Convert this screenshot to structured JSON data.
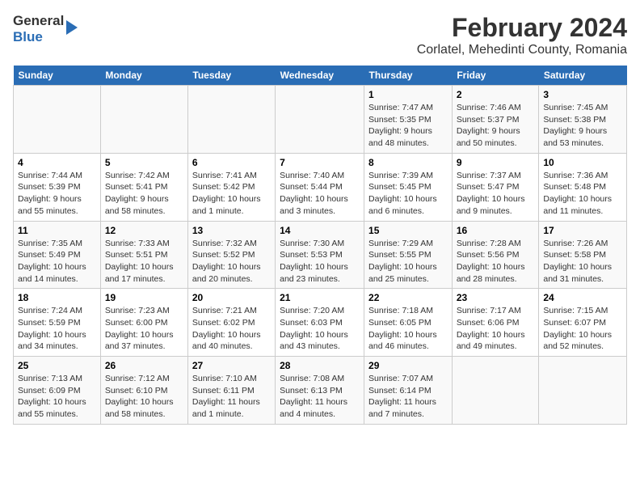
{
  "header": {
    "logo_line1": "General",
    "logo_line2": "Blue",
    "title": "February 2024",
    "subtitle": "Corlatel, Mehedinti County, Romania"
  },
  "days_of_week": [
    "Sunday",
    "Monday",
    "Tuesday",
    "Wednesday",
    "Thursday",
    "Friday",
    "Saturday"
  ],
  "weeks": [
    [
      {
        "num": "",
        "sunrise": "",
        "sunset": "",
        "daylight": ""
      },
      {
        "num": "",
        "sunrise": "",
        "sunset": "",
        "daylight": ""
      },
      {
        "num": "",
        "sunrise": "",
        "sunset": "",
        "daylight": ""
      },
      {
        "num": "",
        "sunrise": "",
        "sunset": "",
        "daylight": ""
      },
      {
        "num": "1",
        "sunrise": "Sunrise: 7:47 AM",
        "sunset": "Sunset: 5:35 PM",
        "daylight": "Daylight: 9 hours and 48 minutes."
      },
      {
        "num": "2",
        "sunrise": "Sunrise: 7:46 AM",
        "sunset": "Sunset: 5:37 PM",
        "daylight": "Daylight: 9 hours and 50 minutes."
      },
      {
        "num": "3",
        "sunrise": "Sunrise: 7:45 AM",
        "sunset": "Sunset: 5:38 PM",
        "daylight": "Daylight: 9 hours and 53 minutes."
      }
    ],
    [
      {
        "num": "4",
        "sunrise": "Sunrise: 7:44 AM",
        "sunset": "Sunset: 5:39 PM",
        "daylight": "Daylight: 9 hours and 55 minutes."
      },
      {
        "num": "5",
        "sunrise": "Sunrise: 7:42 AM",
        "sunset": "Sunset: 5:41 PM",
        "daylight": "Daylight: 9 hours and 58 minutes."
      },
      {
        "num": "6",
        "sunrise": "Sunrise: 7:41 AM",
        "sunset": "Sunset: 5:42 PM",
        "daylight": "Daylight: 10 hours and 1 minute."
      },
      {
        "num": "7",
        "sunrise": "Sunrise: 7:40 AM",
        "sunset": "Sunset: 5:44 PM",
        "daylight": "Daylight: 10 hours and 3 minutes."
      },
      {
        "num": "8",
        "sunrise": "Sunrise: 7:39 AM",
        "sunset": "Sunset: 5:45 PM",
        "daylight": "Daylight: 10 hours and 6 minutes."
      },
      {
        "num": "9",
        "sunrise": "Sunrise: 7:37 AM",
        "sunset": "Sunset: 5:47 PM",
        "daylight": "Daylight: 10 hours and 9 minutes."
      },
      {
        "num": "10",
        "sunrise": "Sunrise: 7:36 AM",
        "sunset": "Sunset: 5:48 PM",
        "daylight": "Daylight: 10 hours and 11 minutes."
      }
    ],
    [
      {
        "num": "11",
        "sunrise": "Sunrise: 7:35 AM",
        "sunset": "Sunset: 5:49 PM",
        "daylight": "Daylight: 10 hours and 14 minutes."
      },
      {
        "num": "12",
        "sunrise": "Sunrise: 7:33 AM",
        "sunset": "Sunset: 5:51 PM",
        "daylight": "Daylight: 10 hours and 17 minutes."
      },
      {
        "num": "13",
        "sunrise": "Sunrise: 7:32 AM",
        "sunset": "Sunset: 5:52 PM",
        "daylight": "Daylight: 10 hours and 20 minutes."
      },
      {
        "num": "14",
        "sunrise": "Sunrise: 7:30 AM",
        "sunset": "Sunset: 5:53 PM",
        "daylight": "Daylight: 10 hours and 23 minutes."
      },
      {
        "num": "15",
        "sunrise": "Sunrise: 7:29 AM",
        "sunset": "Sunset: 5:55 PM",
        "daylight": "Daylight: 10 hours and 25 minutes."
      },
      {
        "num": "16",
        "sunrise": "Sunrise: 7:28 AM",
        "sunset": "Sunset: 5:56 PM",
        "daylight": "Daylight: 10 hours and 28 minutes."
      },
      {
        "num": "17",
        "sunrise": "Sunrise: 7:26 AM",
        "sunset": "Sunset: 5:58 PM",
        "daylight": "Daylight: 10 hours and 31 minutes."
      }
    ],
    [
      {
        "num": "18",
        "sunrise": "Sunrise: 7:24 AM",
        "sunset": "Sunset: 5:59 PM",
        "daylight": "Daylight: 10 hours and 34 minutes."
      },
      {
        "num": "19",
        "sunrise": "Sunrise: 7:23 AM",
        "sunset": "Sunset: 6:00 PM",
        "daylight": "Daylight: 10 hours and 37 minutes."
      },
      {
        "num": "20",
        "sunrise": "Sunrise: 7:21 AM",
        "sunset": "Sunset: 6:02 PM",
        "daylight": "Daylight: 10 hours and 40 minutes."
      },
      {
        "num": "21",
        "sunrise": "Sunrise: 7:20 AM",
        "sunset": "Sunset: 6:03 PM",
        "daylight": "Daylight: 10 hours and 43 minutes."
      },
      {
        "num": "22",
        "sunrise": "Sunrise: 7:18 AM",
        "sunset": "Sunset: 6:05 PM",
        "daylight": "Daylight: 10 hours and 46 minutes."
      },
      {
        "num": "23",
        "sunrise": "Sunrise: 7:17 AM",
        "sunset": "Sunset: 6:06 PM",
        "daylight": "Daylight: 10 hours and 49 minutes."
      },
      {
        "num": "24",
        "sunrise": "Sunrise: 7:15 AM",
        "sunset": "Sunset: 6:07 PM",
        "daylight": "Daylight: 10 hours and 52 minutes."
      }
    ],
    [
      {
        "num": "25",
        "sunrise": "Sunrise: 7:13 AM",
        "sunset": "Sunset: 6:09 PM",
        "daylight": "Daylight: 10 hours and 55 minutes."
      },
      {
        "num": "26",
        "sunrise": "Sunrise: 7:12 AM",
        "sunset": "Sunset: 6:10 PM",
        "daylight": "Daylight: 10 hours and 58 minutes."
      },
      {
        "num": "27",
        "sunrise": "Sunrise: 7:10 AM",
        "sunset": "Sunset: 6:11 PM",
        "daylight": "Daylight: 11 hours and 1 minute."
      },
      {
        "num": "28",
        "sunrise": "Sunrise: 7:08 AM",
        "sunset": "Sunset: 6:13 PM",
        "daylight": "Daylight: 11 hours and 4 minutes."
      },
      {
        "num": "29",
        "sunrise": "Sunrise: 7:07 AM",
        "sunset": "Sunset: 6:14 PM",
        "daylight": "Daylight: 11 hours and 7 minutes."
      },
      {
        "num": "",
        "sunrise": "",
        "sunset": "",
        "daylight": ""
      },
      {
        "num": "",
        "sunrise": "",
        "sunset": "",
        "daylight": ""
      }
    ]
  ]
}
